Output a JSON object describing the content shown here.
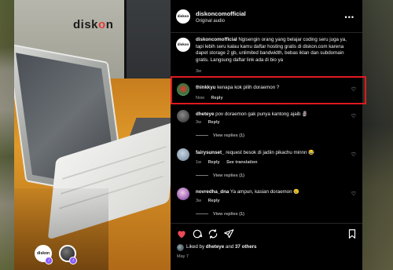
{
  "post": {
    "brand_logo_text": "diskon",
    "media_avatar_1_text": "diskon",
    "header": {
      "username": "diskoncomofficial",
      "subtitle": "Original audio",
      "more": "•••"
    },
    "caption": {
      "username": "diskoncomofficial",
      "text": "Ngisengin orang yang belajar coding seru juga ya, tapi lebih seru kalau kamu daftar hosting gratis di diskon.com karena dapet storage 2 gb, unlimited bandwidth, bebas iklan dan subdomain gratis. Langsung daftar link ada di bio ya",
      "time": "3w"
    },
    "comments": [
      {
        "username": "thinkkyu",
        "text": "kenapa kok pilih doraemon ?",
        "time": "Now",
        "reply": "Reply",
        "view_replies": ""
      },
      {
        "username": "dheteye",
        "text": "pov doraemon gak punya kantong ajaib 🗿",
        "time": "3w",
        "reply": "Reply",
        "view_replies": "View replies (1)"
      },
      {
        "username": "fairysunset_",
        "text": "request besok di jadiin pikachu minnn 😂",
        "time": "1w",
        "reply": "Reply",
        "see_translation": "See translation",
        "view_replies": "View replies (1)"
      },
      {
        "username": "novredha_dna",
        "text": "Ya ampun, kasian doraemon 😢",
        "time": "3w",
        "reply": "Reply",
        "view_replies": "View replies (1)"
      }
    ],
    "likes": {
      "prefix": "Liked by",
      "user": "dheteye",
      "and": "and",
      "others": "37 others"
    },
    "date": "May 7",
    "colors": {
      "highlight": "#e0191f",
      "like_red": "#ed4956",
      "badge_purple": "#8a5cf5"
    },
    "icons": [
      "heart-icon",
      "comment-icon",
      "share-icon",
      "send-icon",
      "bookmark-icon",
      "more-icon"
    ]
  }
}
